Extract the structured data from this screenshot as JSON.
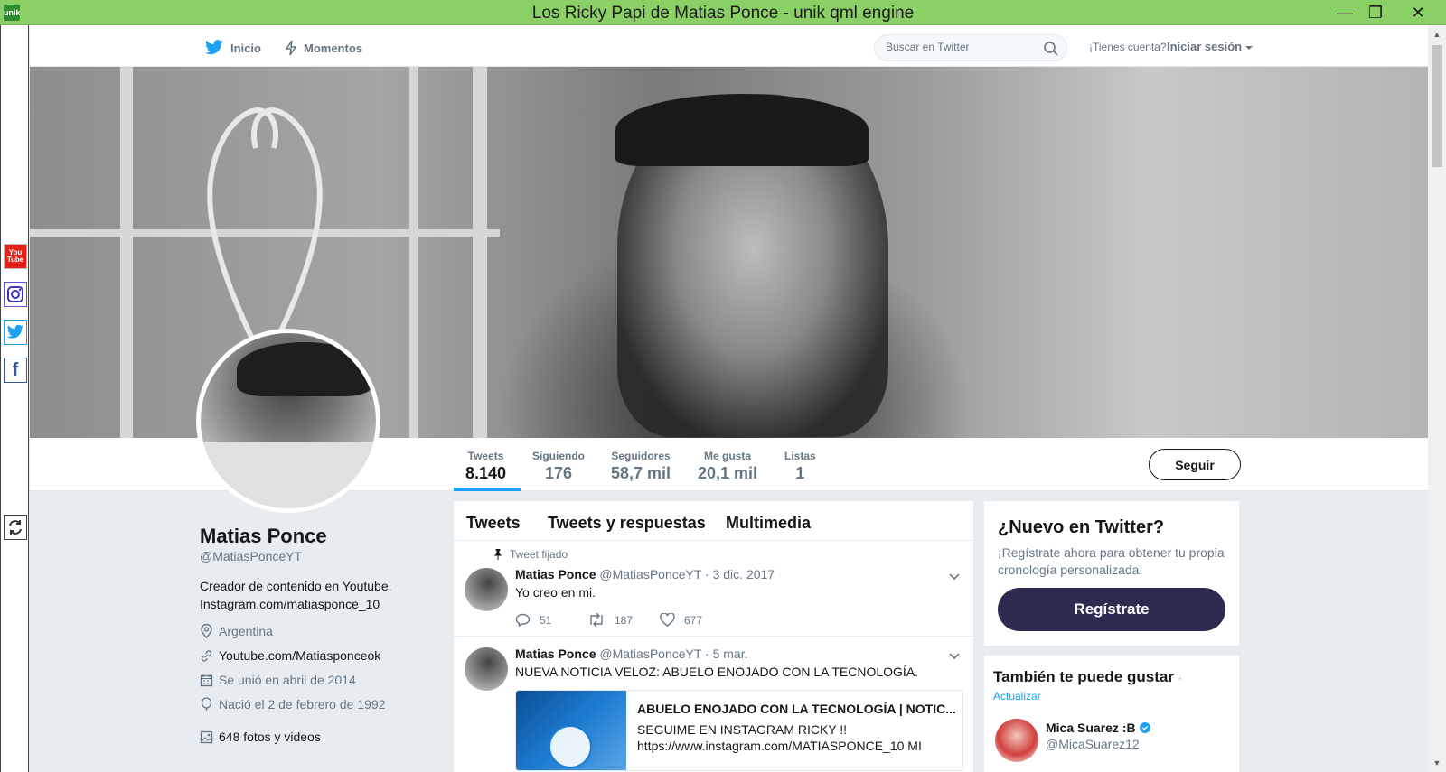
{
  "window": {
    "title": "Los Ricky Papi de Matias Ponce - unik qml engine",
    "app_icon": "unik",
    "minimize": "—",
    "maximize": "❐",
    "close": "✕"
  },
  "side_social": {
    "youtube_line1": "You",
    "youtube_line2": "Tube",
    "facebook": "f"
  },
  "nav": {
    "home": "Inicio",
    "moments": "Momentos",
    "search_placeholder": "Buscar en Twitter",
    "account_prompt": "¡Tienes cuenta?",
    "login": "Iniciar sesión"
  },
  "profile": {
    "name": "Matias Ponce",
    "handle": "@MatiasPonceYT",
    "bio_line1": "Creador de contenido en Youtube.",
    "bio_line2": "Instagram.com/matiasponce_10",
    "location": "Argentina",
    "website": "Youtube.com/Matiasponceok",
    "joined": "Se unió en abril de 2014",
    "birthday": "Nació el 2 de febrero de 1992",
    "media": "648 fotos y videos"
  },
  "stats": [
    {
      "label": "Tweets",
      "value": "8.140"
    },
    {
      "label": "Siguiendo",
      "value": "176"
    },
    {
      "label": "Seguidores",
      "value": "58,7 mil"
    },
    {
      "label": "Me gusta",
      "value": "20,1 mil"
    },
    {
      "label": "Listas",
      "value": "1"
    }
  ],
  "follow_button": "Seguir",
  "timeline": {
    "tabs": [
      "Tweets",
      "Tweets y respuestas",
      "Multimedia"
    ],
    "pinned_label": "Tweet fijado",
    "tweets": [
      {
        "name": "Matias Ponce",
        "handle": "@MatiasPonceYT",
        "date": "· 3 dic. 2017",
        "text": "Yo creo en mi.",
        "replies": "51",
        "retweets": "187",
        "likes": "677"
      },
      {
        "name": "Matias Ponce",
        "handle": "@MatiasPonceYT",
        "date": "· 5 mar.",
        "text": "NUEVA NOTICIA VELOZ: ABUELO ENOJADO CON LA TECNOLOGÍA.",
        "card_title": "ABUELO ENOJADO CON LA TECNOLOGÍA | NOTIC...",
        "card_desc_line1": "SEGUIME EN INSTAGRAM RICKY !!",
        "card_desc_line2": "https://www.instagram.com/MATIASPONCE_10 MI"
      }
    ]
  },
  "signup": {
    "title": "¿Nuevo en Twitter?",
    "subtitle": "¡Regístrate ahora para obtener tu propia cronología personalizada!",
    "button": "Regístrate"
  },
  "who_to_follow": {
    "title": "También te puede gustar",
    "separator": "·",
    "refresh": "Actualizar",
    "users": [
      {
        "name": "Mica Suarez :B",
        "handle": "@MicaSuarez12"
      }
    ]
  },
  "colors": {
    "titlebar": "#8bd067",
    "twitter_blue": "#1da1f2",
    "signup_button": "#2d2b4f"
  }
}
